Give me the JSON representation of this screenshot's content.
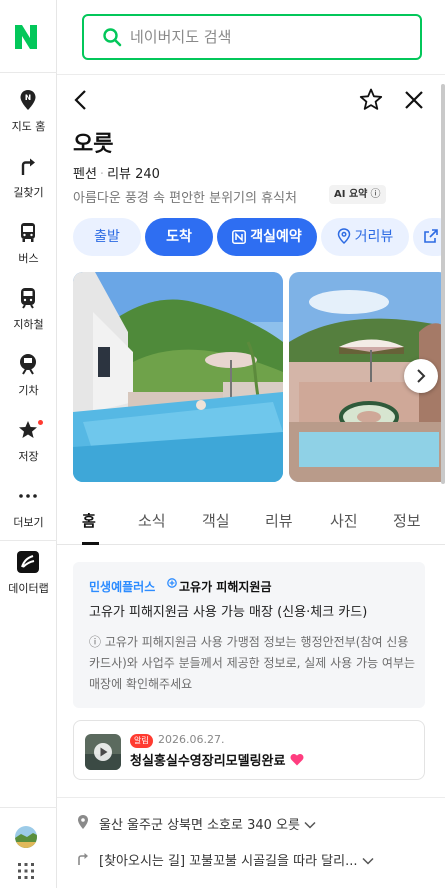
{
  "search": {
    "placeholder": "네이버지도 검색"
  },
  "sidebar": {
    "items": [
      {
        "label": "지도 홈",
        "icon": "map-pin-icon"
      },
      {
        "label": "길찾기",
        "icon": "directions-icon"
      },
      {
        "label": "버스",
        "icon": "bus-icon"
      },
      {
        "label": "지하철",
        "icon": "subway-icon"
      },
      {
        "label": "기차",
        "icon": "train-icon"
      },
      {
        "label": "저장",
        "icon": "star-icon"
      },
      {
        "label": "더보기",
        "icon": "more-icon"
      },
      {
        "label": "데이터랩",
        "icon": "datalab-icon"
      }
    ]
  },
  "place": {
    "name": "오릇",
    "category": "펜션",
    "review_count": "리뷰 240",
    "description": "아름다운 풍경 속 편안한 분위기의 휴식처",
    "ai_badge": "AI 요약",
    "ai_badge_info": "ⓘ"
  },
  "actions": {
    "departure": "출발",
    "arrival": "도착",
    "room_booking": "객실예약",
    "street_view": "거리뷰"
  },
  "tabs": [
    "홈",
    "소식",
    "객실",
    "리뷰",
    "사진",
    "정보"
  ],
  "benefit": {
    "brand_label": "민생예플러스",
    "title": "고유가 피해지원금",
    "line": "고유가 피해지원금 사용 가능 매장 (신용·체크 카드)",
    "note": "ⓘ 고유가 피해지원금 사용 가맹점 정보는 행정안전부(참여 신용카드사)와 사업주 분들께서 제공한 정보로, 실제 사용 가능 여부는 매장에 확인해주세요"
  },
  "notice": {
    "tag": "알림",
    "date": "2026.06.27.",
    "title": "청실홍실수영장리모델링완료"
  },
  "info": {
    "address": "울산 울주군 상북면 소호로 340 오릇",
    "directions": "[찾아오시는 길] 꼬불꼬불 시골길을 따라 달리..."
  },
  "colors": {
    "brand_green": "#03c75a",
    "primary_blue": "#2e6ef2",
    "light_blue": "#eaf1ff"
  }
}
